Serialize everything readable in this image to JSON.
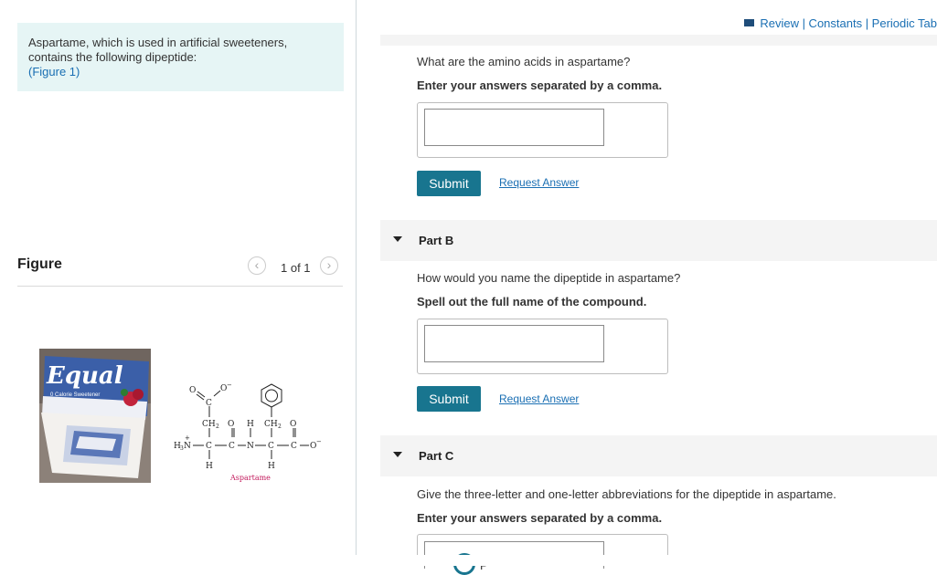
{
  "intro": {
    "line1": "Aspartame, which is used in artificial sweeteners,",
    "line2": "contains the following dipeptide:",
    "figure_link": "(Figure 1)"
  },
  "figure": {
    "title": "Figure",
    "counter": "1 of 1",
    "prev_icon": "chevron-left-icon",
    "next_icon": "chevron-right-icon",
    "photo_brand": "Equal",
    "photo_tagline": "0 Calorie Sweetener",
    "structure_caption": "Aspartame",
    "structure_labels": {
      "o_top_left": "O",
      "o_top_right": "O",
      "c_top": "C",
      "minus_top": "−",
      "ch2_left": "CH",
      "ch2_left_sub": "2",
      "o_mid1": "O",
      "h_mid": "H",
      "ch2_right": "CH",
      "ch2_right_sub": "2",
      "o_mid2": "O",
      "h3n": "H",
      "h3n_sub": "3",
      "h3n_n": "N",
      "h3n_plus": "+",
      "c1": "C",
      "c2": "C",
      "n_mid": "N",
      "c3": "C",
      "c4": "C",
      "o_end": "O",
      "minus_end": "−",
      "h_bottom_left": "H",
      "h_bottom_right": "H"
    }
  },
  "toplinks": {
    "text": "Review | Constants | Periodic Tab",
    "icon": "book-icon"
  },
  "part_a": {
    "question": "What are the amino acids in aspartame?",
    "instruction": "Enter your answers separated by a comma.",
    "answer_value": "",
    "submit_label": "Submit",
    "request_label": "Request Answer"
  },
  "part_b": {
    "title": "Part B",
    "question": "How would you name the dipeptide in aspartame?",
    "instruction": "Spell out the full name of the compound.",
    "answer_value": "",
    "submit_label": "Submit",
    "request_label": "Request Answer"
  },
  "part_c": {
    "title": "Part C",
    "question": "Give the three-letter and one-letter abbreviations for the dipeptide in aspartame.",
    "instruction": "Enter your answers separated by a comma.",
    "partial_text": "P"
  },
  "colors": {
    "accent": "#18758f",
    "link": "#1a6fb3",
    "intro_bg": "#e6f5f5",
    "caption": "#c2185b"
  }
}
